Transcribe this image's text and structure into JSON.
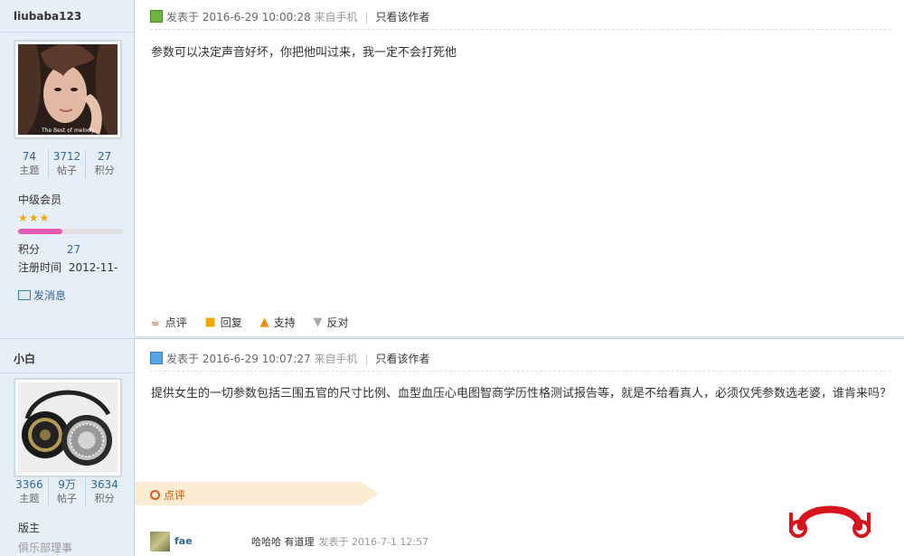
{
  "post1": {
    "username": "liubaba123",
    "stats": [
      {
        "value": "74",
        "label": "主题"
      },
      {
        "value": "3712",
        "label": "帖子"
      },
      {
        "value": "27",
        "label": "积分"
      }
    ],
    "avatar_caption": "The Best of melody.",
    "rank": "中级会员",
    "stars": "★★★",
    "points_label": "积分",
    "points_value": "27",
    "reg_label": "注册时间",
    "reg_value": "2012-11-",
    "send_msg": "发消息",
    "meta_posted": "发表于 2016-6-29 10:00:28",
    "meta_source": "来自手机",
    "meta_only_author": "只看该作者",
    "content": "参数可以决定声音好坏，你把他叫过来，我一定不会打死他",
    "actions": {
      "comment": "点评",
      "reply": "回复",
      "support": "支持",
      "oppose": "反对"
    }
  },
  "post2": {
    "username": "小白",
    "stats": [
      {
        "value": "3366",
        "label": "主题"
      },
      {
        "value": "9万",
        "label": "帖子"
      },
      {
        "value": "3634",
        "label": "积分"
      }
    ],
    "rank": "版主",
    "group": "俱乐部理事",
    "meta_posted": "发表于 2016-6-29 10:07:27",
    "meta_source": "来自手机",
    "meta_only_author": "只看该作者",
    "content": "提供女生的一切参数包括三围五官的尺寸比例、血型血压心电图智商学历性格测试报告等，就是不给看真人，必须仅凭参数选老婆，谁肯来吗？",
    "comment_label": "点评",
    "review": {
      "user": "fae",
      "text": "哈哈哈 有道理",
      "date": "发表于 2016-7-1 12:57"
    }
  },
  "colors": {
    "accent": "#336699",
    "sidebar_bg": "#e6eef7",
    "ribbon_bg": "#fbecd3",
    "logo_red": "#d8141c"
  }
}
